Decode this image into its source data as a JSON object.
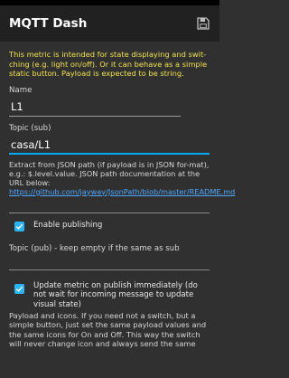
{
  "app": {
    "title": "MQTT Dash",
    "save_icon": "save-icon"
  },
  "colors": {
    "accent": "#03a9f4",
    "info_text": "#f1e24c",
    "link": "#4fa8ff",
    "background": "#303030",
    "appbar": "#212121"
  },
  "info": "This metric is intended for state displaying and swit-ching (e.g. light on/off). Or it can behave as a simple static button. Payload is expected to be string.",
  "name": {
    "label": "Name",
    "value": "L1"
  },
  "topic_sub": {
    "label": "Topic (sub)",
    "value": "casa/L1"
  },
  "json_path": {
    "help": "Extract from JSON path (if payload is in JSON for-mat), e.g.: $.level.value. JSON path documentation at the URL below:",
    "link": "https://github.com/jayway/JsonPath/blob/master/README.md"
  },
  "enable_publishing": {
    "label": "Enable publishing",
    "checked": true
  },
  "topic_pub": {
    "label": "Topic (pub) - keep empty if the same as sub"
  },
  "update_metric": {
    "label": "Update metric on publish immediately (do not wait for incoming message to update visual state)",
    "checked": true
  },
  "payload_text": "Payload and icons. If you need not a switch, but a simple button, just set the same payload values and the same icons for On and Off. This way the switch will never change icon and always send the same"
}
